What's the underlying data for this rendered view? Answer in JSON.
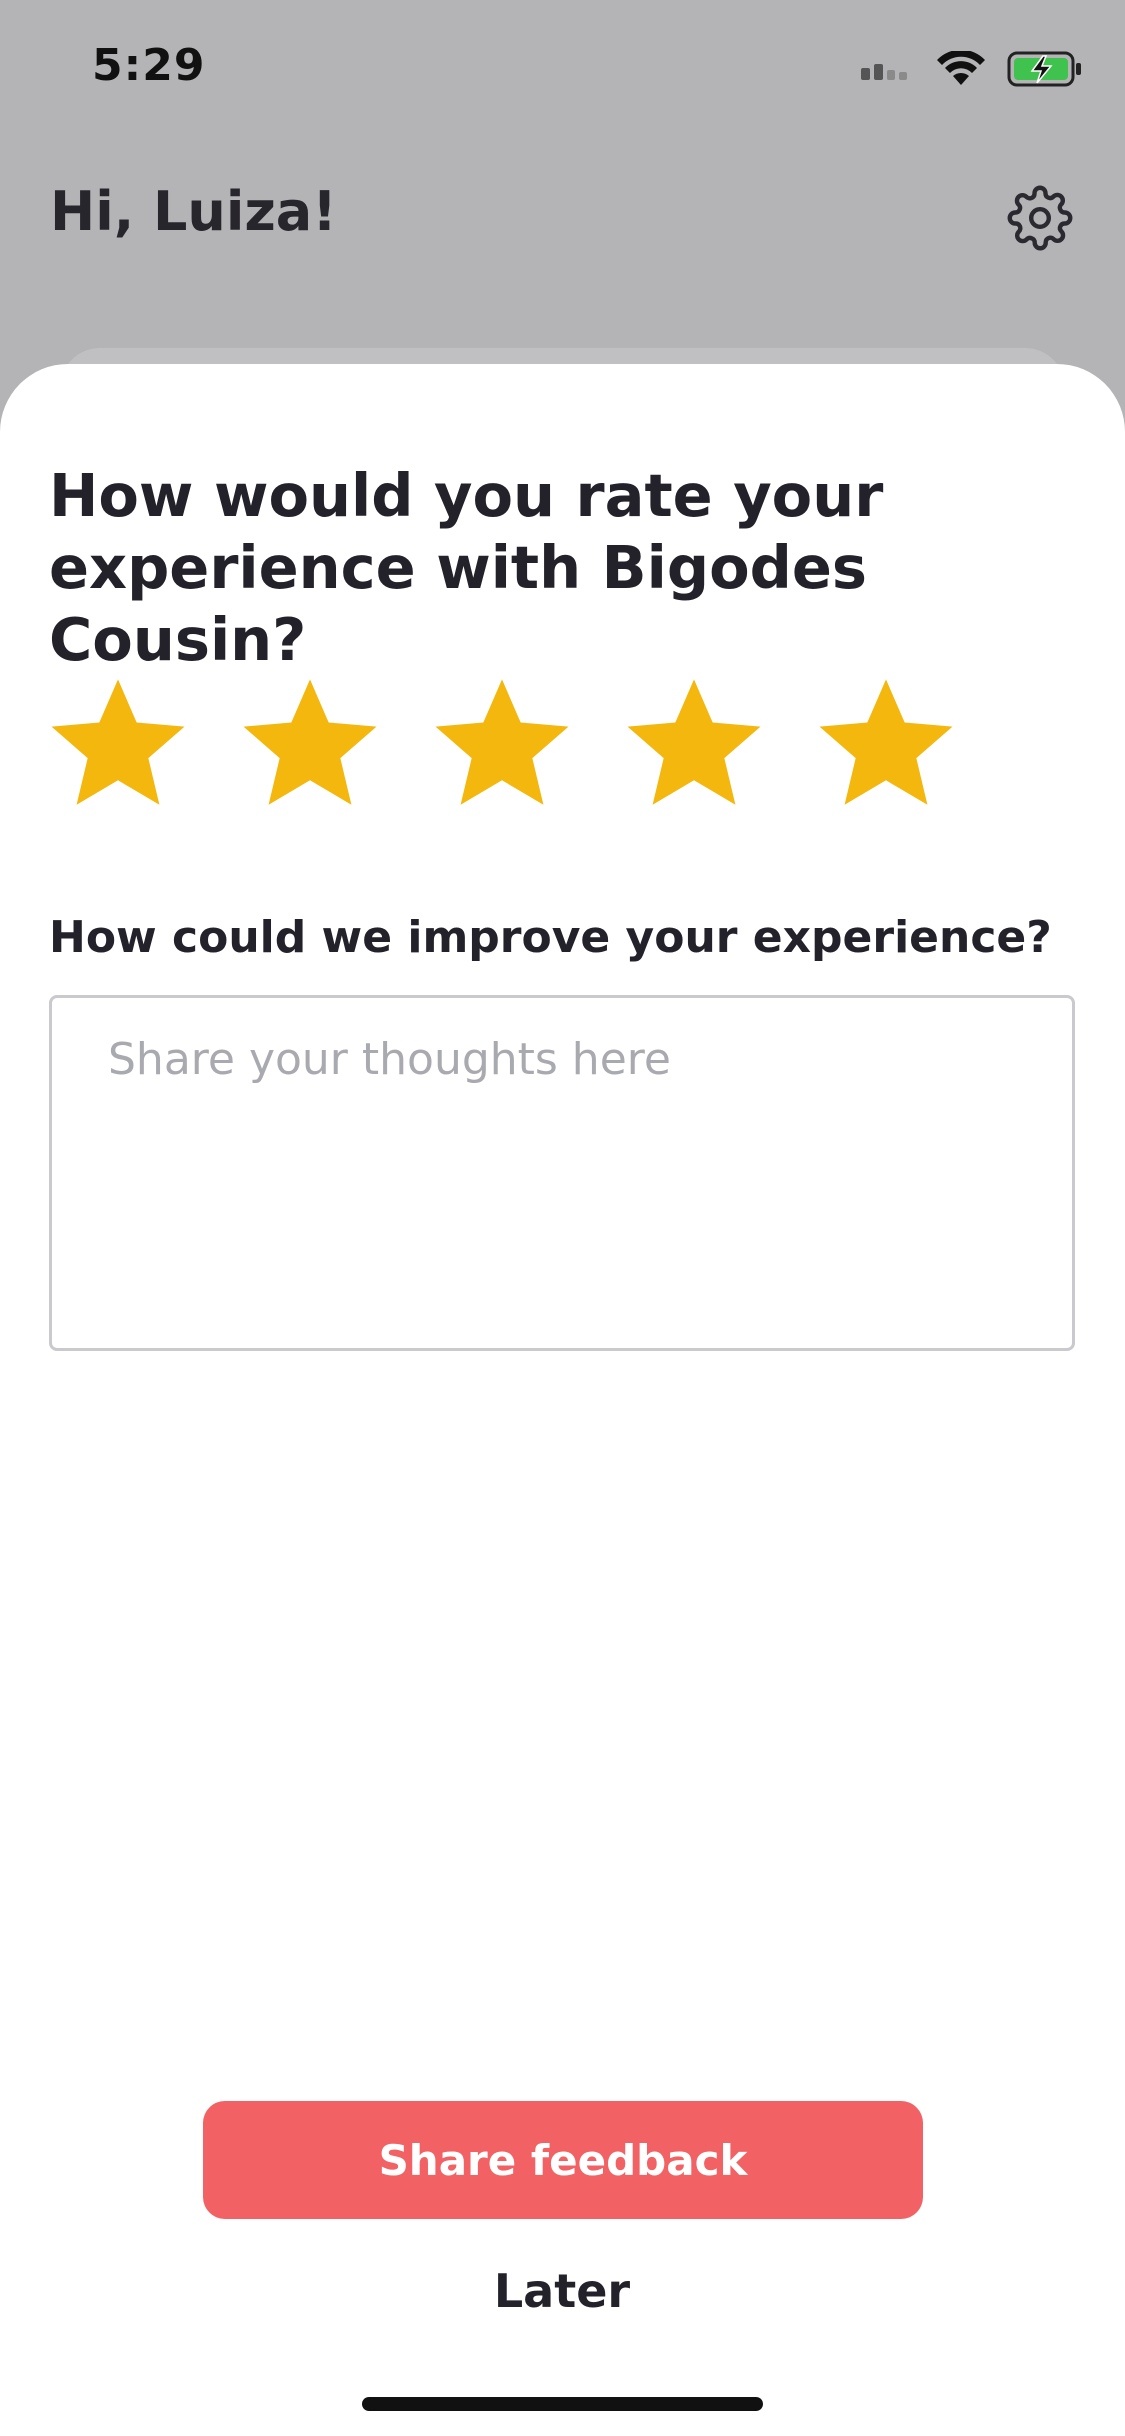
{
  "status_bar": {
    "time": "5:29"
  },
  "header": {
    "greeting": "Hi, Luiza!"
  },
  "rating": {
    "question": "How would you rate your experience with Bigodes Cousin?",
    "stars_max": 5,
    "stars_selected": 5,
    "star_color": "#F4B70E"
  },
  "feedback": {
    "label": "How could we improve your experience?",
    "placeholder": "Share your thoughts here",
    "value": ""
  },
  "actions": {
    "share_label": "Share feedback",
    "share_color": "#F26264",
    "later_label": "Later"
  }
}
